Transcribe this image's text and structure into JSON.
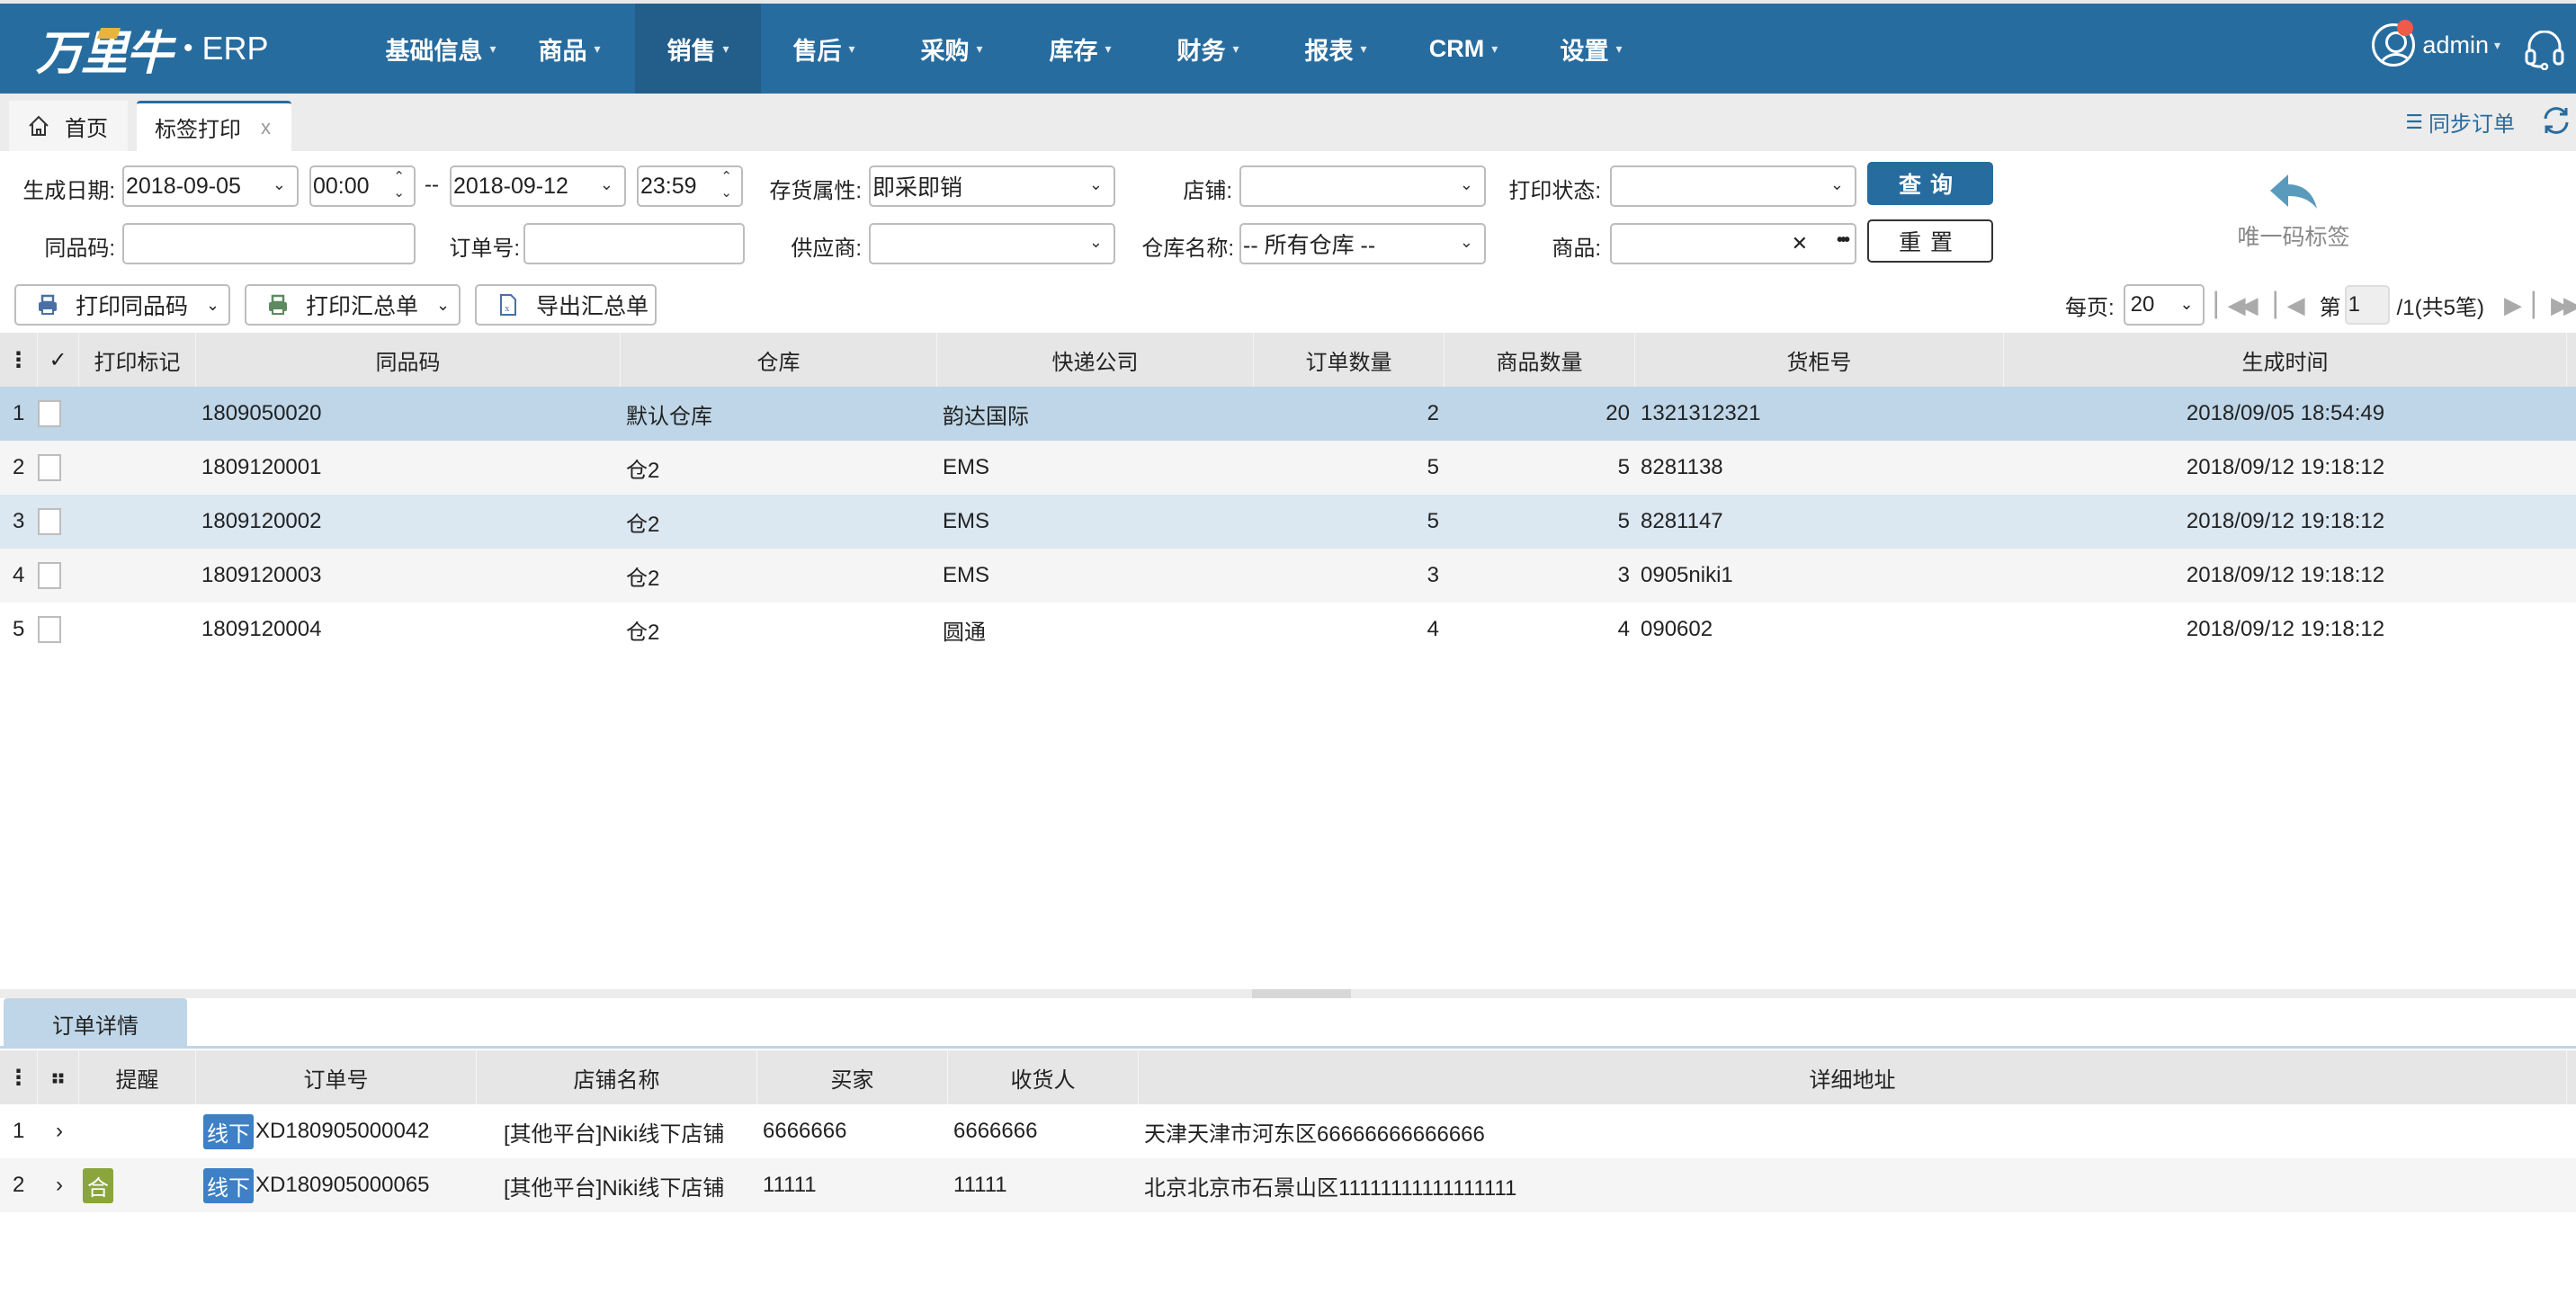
{
  "header": {
    "logo_text": "万里牛",
    "logo_dot": "•",
    "logo_suffix": "ERP",
    "nav": [
      {
        "label": "基础信息",
        "active": false
      },
      {
        "label": "商品",
        "active": false
      },
      {
        "label": "销售",
        "active": true
      },
      {
        "label": "售后",
        "active": false
      },
      {
        "label": "采购",
        "active": false
      },
      {
        "label": "库存",
        "active": false
      },
      {
        "label": "财务",
        "active": false
      },
      {
        "label": "报表",
        "active": false
      },
      {
        "label": "CRM",
        "active": false
      },
      {
        "label": "设置",
        "active": false
      }
    ],
    "caret": "▾",
    "user": "admin",
    "colors": {
      "brand": "#276c9f",
      "active_nav": "#235d8a",
      "notify": "#f05a48"
    }
  },
  "tabs": {
    "home": "首页",
    "current": "标签打印",
    "close": "x",
    "sync_label": "同步订单",
    "sync_icon": "☰"
  },
  "filters": {
    "gen_date_label": "生成日期:",
    "date_from": "2018-09-05",
    "time_from": "00:00",
    "range_sep": "--",
    "date_to": "2018-09-12",
    "time_to": "23:59",
    "stock_attr_label": "存货属性:",
    "stock_attr_value": "即采即销",
    "shop_label": "店铺:",
    "shop_value": "",
    "print_status_label": "打印状态:",
    "print_status_value": "",
    "same_code_label": "同品码:",
    "same_code_value": "",
    "order_no_label": "订单号:",
    "order_no_value": "",
    "supplier_label": "供应商:",
    "supplier_value": "",
    "warehouse_label": "仓库名称:",
    "warehouse_value": "-- 所有仓库 --",
    "goods_label": "商品:",
    "goods_value": "",
    "goods_clear": "✕",
    "goods_more": "•••",
    "query_button": "查询",
    "reset_button": "重置",
    "unique_label": "唯一码标签"
  },
  "toolbar": {
    "print_same_code": "打印同品码",
    "print_summary": "打印汇总单",
    "export_summary": "导出汇总单"
  },
  "pager": {
    "per_page_label": "每页:",
    "per_page_value": "20",
    "page_prefix": "第",
    "current_page": "1",
    "page_suffix": "/1(共5笔)"
  },
  "grid": {
    "columns": [
      "打印标记",
      "同品码",
      "仓库",
      "快递公司",
      "订单数量",
      "商品数量",
      "货柜号",
      "生成时间"
    ],
    "menu_icon": "⋮",
    "check_all": "✓",
    "rows": [
      {
        "idx": "1",
        "print_mark": "",
        "code": "1809050020",
        "warehouse": "默认仓库",
        "express": "韵达国际",
        "order_qty": "2",
        "goods_qty": "20",
        "cabinet": "1321312321",
        "created": "2018/09/05 18:54:49",
        "state": "selected"
      },
      {
        "idx": "2",
        "print_mark": "",
        "code": "1809120001",
        "warehouse": "仓2",
        "express": "EMS",
        "order_qty": "5",
        "goods_qty": "5",
        "cabinet": "8281138",
        "created": "2018/09/12 19:18:12",
        "state": "alt"
      },
      {
        "idx": "3",
        "print_mark": "",
        "code": "1809120002",
        "warehouse": "仓2",
        "express": "EMS",
        "order_qty": "5",
        "goods_qty": "5",
        "cabinet": "8281147",
        "created": "2018/09/12 19:18:12",
        "state": "hover"
      },
      {
        "idx": "4",
        "print_mark": "",
        "code": "1809120003",
        "warehouse": "仓2",
        "express": "EMS",
        "order_qty": "3",
        "goods_qty": "3",
        "cabinet": "0905niki1",
        "created": "2018/09/12 19:18:12",
        "state": "alt"
      },
      {
        "idx": "5",
        "print_mark": "",
        "code": "1809120004",
        "warehouse": "仓2",
        "express": "圆通",
        "order_qty": "4",
        "goods_qty": "4",
        "cabinet": "090602",
        "created": "2018/09/12 19:18:12",
        "state": "white"
      }
    ]
  },
  "detail": {
    "tab_label": "订单详情",
    "columns": [
      "提醒",
      "订单号",
      "店铺名称",
      "买家",
      "收货人",
      "详细地址"
    ],
    "menu_icon": "⋮",
    "grid_icon": "⠶",
    "rows": [
      {
        "idx": "1",
        "remind_tag": "",
        "channel_tag": "线下",
        "order_no": "XD180905000042",
        "shop": "[其他平台]Niki线下店铺",
        "buyer": "6666666",
        "receiver": "6666666",
        "address": "天津天津市河东区66666666666666"
      },
      {
        "idx": "2",
        "remind_tag": "合",
        "channel_tag": "线下",
        "order_no": "XD180905000065",
        "shop": "[其他平台]Niki线下店铺",
        "buyer": "11111",
        "receiver": "11111",
        "address": "北京北京市石景山区11111111111111111"
      }
    ],
    "expand_icon": "›"
  }
}
